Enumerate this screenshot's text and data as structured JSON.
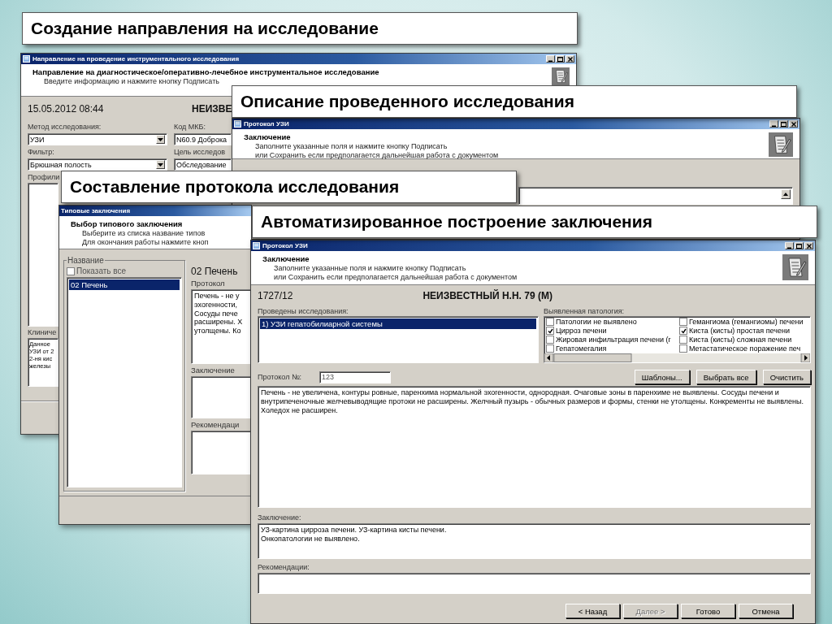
{
  "referral_window": {
    "caption": "Создание направления на исследование",
    "title": "Направление на проведение инструментального исследования",
    "heading": "Направление на диагностическое/оперативно-лечебное инструментальное исследование",
    "instruction": "Введите информацию и нажмите кнопку Подписать",
    "datetime": "15.05.2012 08:44",
    "patient": "НЕИЗВЕ",
    "left_fields": [
      {
        "label": "Метод исследования:",
        "value": "УЗИ"
      },
      {
        "label": "Фильтр:",
        "value": "Брюшная полость"
      }
    ],
    "right_fields": [
      {
        "label": "Код МКБ:",
        "value": "N60.9 Доброка"
      },
      {
        "label": "Цель исследов",
        "value": "Обследование"
      }
    ],
    "profile_label": "Профили",
    "clinical_label": "Клиниче",
    "clinical_lines": [
      "Данное",
      "УЗИ от 2",
      "2-ня кис",
      "железы"
    ]
  },
  "description_window": {
    "caption": "Описание проведенного исследования",
    "title": "Протокол УЗИ",
    "heading": "Заключение",
    "instructions": [
      "Заполните указанные поля и нажмите кнопку  Подписать",
      "или Сохранить если предполагается дальнейшая работа с документом"
    ]
  },
  "template_window": {
    "caption": "Составление протокола исследования",
    "title": "Типовые заключения",
    "heading": "Выбор типового заключения",
    "instructions": [
      "Выберите из списка название типов",
      "Для окончания работы нажмите кноп"
    ],
    "group_label": "Название",
    "show_all": {
      "label": "Показать все",
      "checked": false
    },
    "items": [
      {
        "label": "02 Печень",
        "selected": true
      }
    ],
    "selected_title": "02 Печень",
    "protocol_label": "Протокол",
    "protocol_lines": [
      "Печень - не у",
      "эхогенности,",
      "Сосуды пече",
      "расширены. Х",
      "утолщены. Ко"
    ],
    "conclusion_label": "Заключение",
    "recommendations_label": "Рекомендаци"
  },
  "protocol_window": {
    "caption": "Автоматизированное построение заключения",
    "title": "Протокол УЗИ",
    "heading": "Заключение",
    "instructions": [
      "Заполните указанные поля и нажмите кнопку  Подписать",
      "или Сохранить если предполагается дальнейшая работа с документом"
    ],
    "record_number": "1727/12",
    "patient": "НЕИЗВЕСТНЫЙ Н.Н.  79 (М)",
    "studies_label": "Проведены исследования:",
    "studies": [
      {
        "label": "1) УЗИ гепатобилиарной системы",
        "selected": true
      }
    ],
    "pathology_label": "Выявленная патология:",
    "pathologies": [
      {
        "label": "Патологии не выявлено",
        "checked": false
      },
      {
        "label": "Цирроз печени",
        "checked": true
      },
      {
        "label": "Жировая инфильтрация печени (г",
        "checked": false
      },
      {
        "label": "Гепатомегалия",
        "checked": false
      },
      {
        "label": "Гемангиома (гемангиомы) печени",
        "checked": false
      },
      {
        "label": "Киста (кисты) простая печени",
        "checked": true
      },
      {
        "label": "Киста (кисты) сложная печени",
        "checked": false
      },
      {
        "label": "Метастатическое поражение печ",
        "checked": false
      }
    ],
    "protocol_number_label": "Протокол №:",
    "protocol_number": "123",
    "tool_buttons": [
      "Шаблоны...",
      "Выбрать все",
      "Очистить"
    ],
    "protocol_text": "Печень - не увеличена, контуры ровные, паренхима нормальной эхогенности, однородная. Очаговые зоны в паренхиме не выявлены. Сосуды печени и внутрипеченочные желчевыводящие протоки не расширены. Желчный пузырь - обычных размеров и формы, стенки не утолщены. Конкременты не выявлены. Холедох не расширен.",
    "conclusion_label": "Заключение:",
    "conclusion_lines": [
      "УЗ-картина цирроза печени. УЗ-картина кисты печени.",
      "Онкопатологии не выявлено."
    ],
    "recommendations_label": "Рекомендации:",
    "nav_buttons": [
      {
        "label": "< Назад",
        "disabled": false
      },
      {
        "label": "Далее >",
        "disabled": true
      },
      {
        "label": "Готово",
        "disabled": false
      },
      {
        "label": "Отмена",
        "disabled": false
      }
    ]
  }
}
